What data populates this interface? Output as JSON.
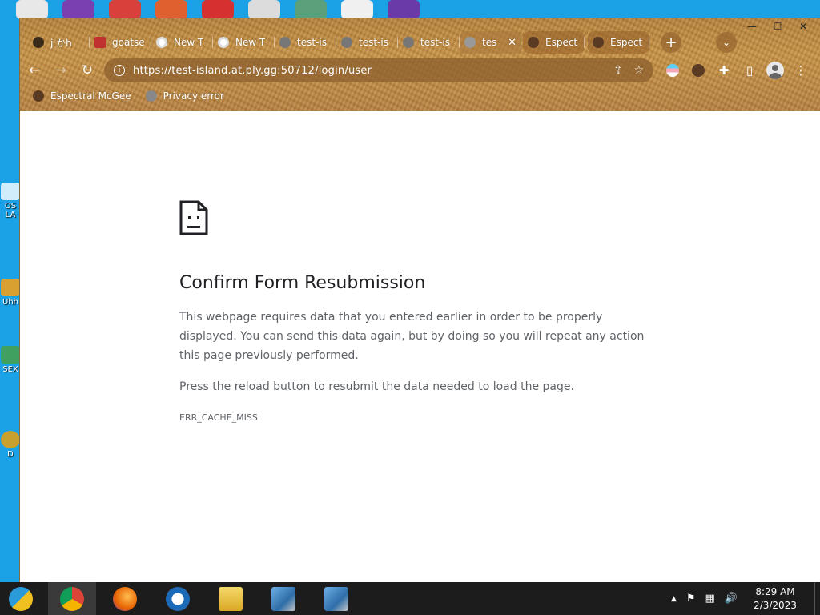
{
  "desktop": {
    "icons": [
      {
        "name": "os-icon",
        "label": "OS LA"
      },
      {
        "name": "uhh-icon",
        "label": "Uhh"
      },
      {
        "name": "sex-icon",
        "label": "SEX"
      },
      {
        "name": "d-icon",
        "label": "D"
      }
    ]
  },
  "browser": {
    "window_controls": {
      "minimize": "—",
      "maximize": "☐",
      "close": "✕"
    },
    "tabs": [
      {
        "label": "j かh",
        "favicon_color": "#3a2a1a"
      },
      {
        "label": "goatse",
        "favicon_color": "#c0312f"
      },
      {
        "label": "New T",
        "favicon_color": "#ffffff"
      },
      {
        "label": "New T",
        "favicon_color": "#ffffff"
      },
      {
        "label": "test-is",
        "favicon_color": "#777777"
      },
      {
        "label": "test-is",
        "favicon_color": "#777777"
      },
      {
        "label": "test-is",
        "favicon_color": "#777777"
      },
      {
        "label": "tes",
        "favicon_color": "#777777",
        "active": true
      },
      {
        "label": "Espect",
        "favicon_color": "#5a3a22"
      },
      {
        "label": "Espect",
        "favicon_color": "#5a3a22"
      }
    ],
    "new_tab": "+",
    "tab_search": "⌄",
    "nav": {
      "back": "←",
      "forward": "→",
      "reload": "↻"
    },
    "omnibox": {
      "info": "i",
      "url": "https://test-island.at.ply.gg:50712/login/user",
      "share_icon": "⇪",
      "star_icon": "☆"
    },
    "extensions": {
      "puzzle": "✚",
      "sidepanel": "▯",
      "menu": "⋮"
    },
    "bookmarks": [
      {
        "label": "Espectral McGee",
        "favicon_color": "#5a3a22"
      },
      {
        "label": "Privacy error",
        "favicon_color": "#888888"
      }
    ]
  },
  "error_page": {
    "title": "Confirm Form Resubmission",
    "paragraph1": "This webpage requires data that you entered earlier in order to be properly displayed. You can send this data again, but by doing so you will repeat any action this page previously performed.",
    "paragraph2": "Press the reload button to resubmit the data needed to load the page.",
    "code": "ERR_CACHE_MISS"
  },
  "taskbar": {
    "tray_up": "▲",
    "flag": "⚑",
    "network": "▦",
    "volume": "🔊",
    "time": "8:29 AM",
    "date": "2/3/2023"
  }
}
